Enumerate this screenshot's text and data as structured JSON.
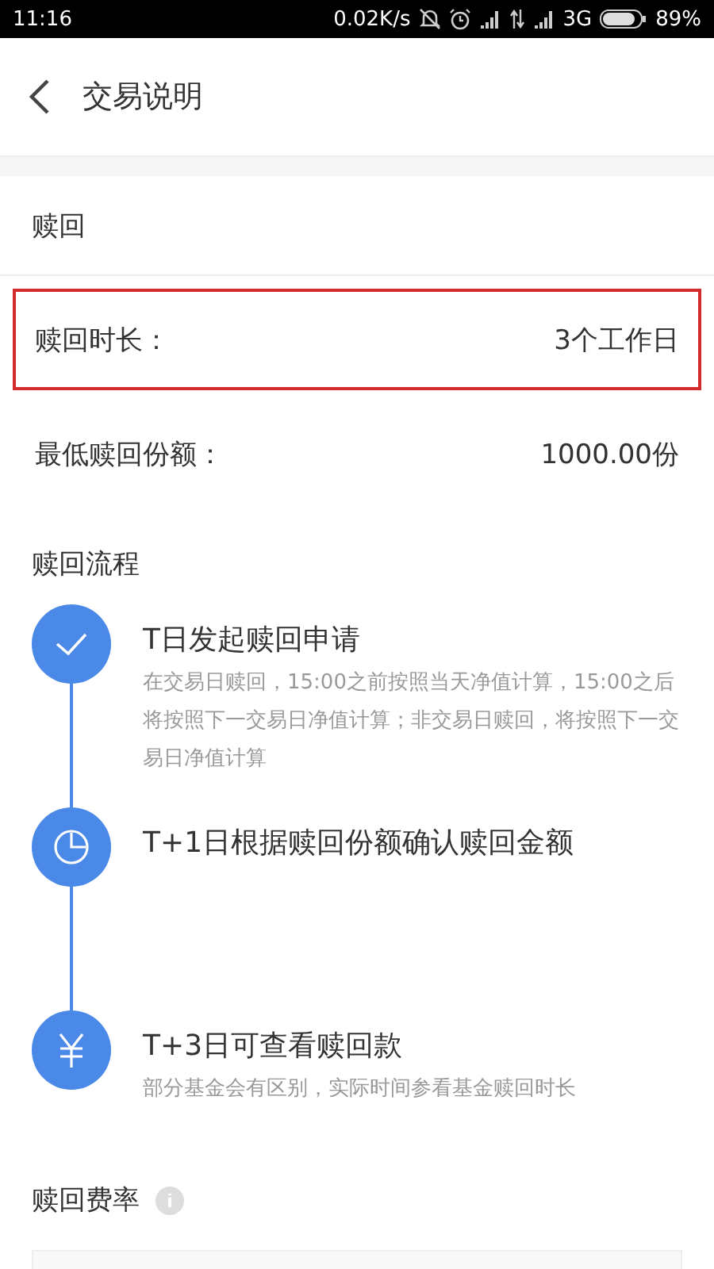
{
  "status_bar": {
    "time": "11:16",
    "speed": "0.02K/s",
    "network": "3G",
    "battery": "89%"
  },
  "header": {
    "title": "交易说明"
  },
  "section": {
    "title": "赎回"
  },
  "rows": [
    {
      "label": "赎回时长：",
      "value": "3个工作日",
      "highlighted": true
    },
    {
      "label": "最低赎回份额：",
      "value": "1000.00份",
      "highlighted": false
    }
  ],
  "process": {
    "title": "赎回流程",
    "steps": [
      {
        "kind": "check",
        "title": "T日发起赎回申请",
        "desc": "在交易日赎回，15:00之前按照当天净值计算，15:00之后将按照下一交易日净值计算；非交易日赎回，将按照下一交易日净值计算"
      },
      {
        "kind": "clock",
        "title": "T+1日根据赎回份额确认赎回金额"
      },
      {
        "kind": "yen",
        "title": "T+3日可查看赎回款",
        "desc": "部分基金会有区别，实际时间参看基金赎回时长"
      }
    ]
  },
  "fees": {
    "title": "赎回费率"
  }
}
